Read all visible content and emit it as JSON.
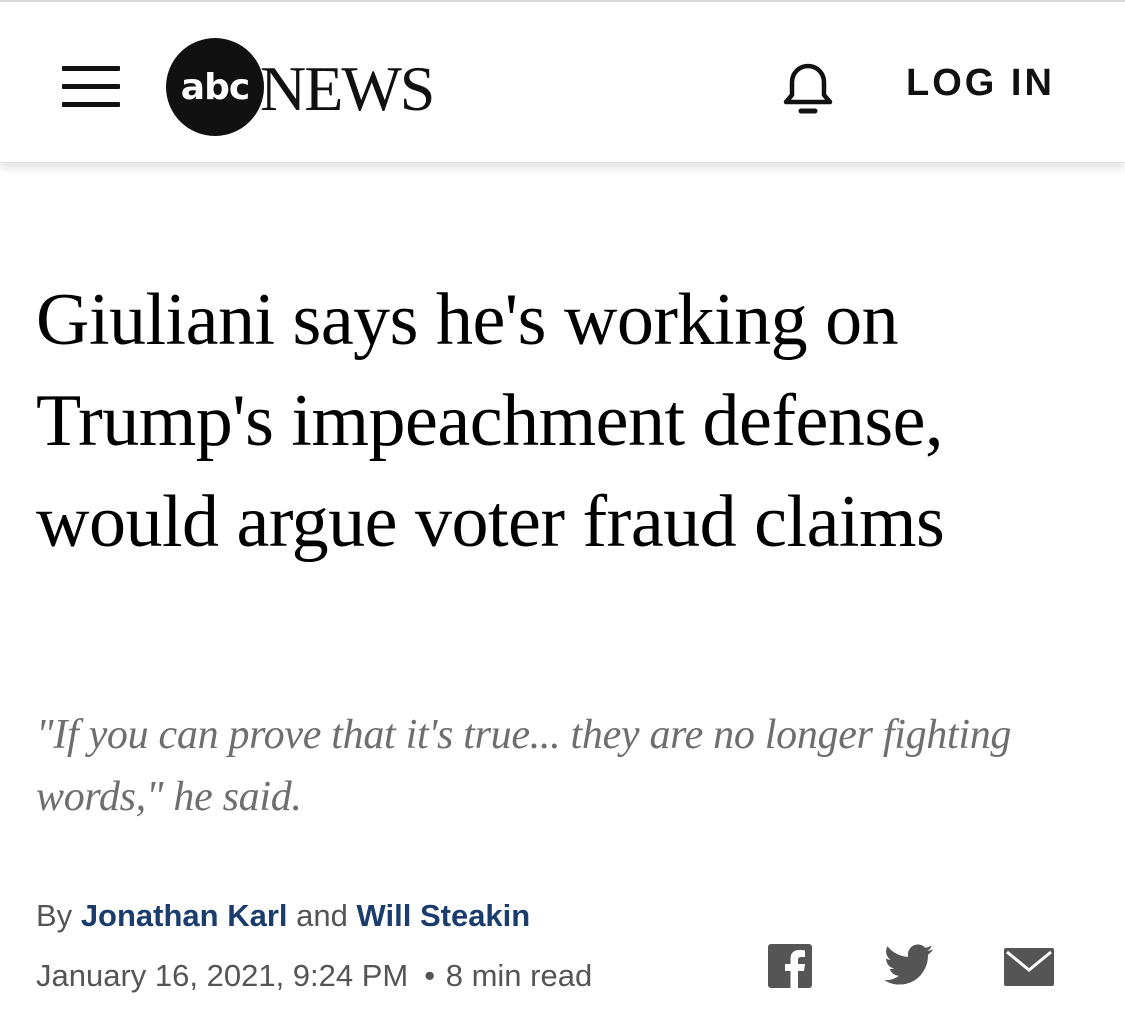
{
  "header": {
    "logo_mark": "abc",
    "logo_wordmark": "NEWS",
    "login_label": "LOG IN",
    "icons": [
      "hamburger-menu-icon",
      "abc-news-logo",
      "bell-icon"
    ]
  },
  "article": {
    "headline": "Giuliani says he's working on Trump's impeachment defense, would argue voter fraud claims",
    "subheadline": "\"If you can prove that it's true... they are no longer fighting words,\" he said.",
    "byline": {
      "prefix": "By",
      "author1": "Jonathan Karl",
      "conjunction": "and",
      "author2": "Will Steakin"
    },
    "date": "January 16, 2021, 9:24 PM",
    "separator": "•",
    "read_time": "8 min read"
  },
  "share": {
    "icons": [
      "facebook-icon",
      "twitter-icon",
      "email-icon"
    ]
  },
  "colors": {
    "text": "#000000",
    "subhead": "#6e6e6e",
    "author_link": "#1b3d6d",
    "meta": "#555555",
    "share_icon": "#555555"
  }
}
